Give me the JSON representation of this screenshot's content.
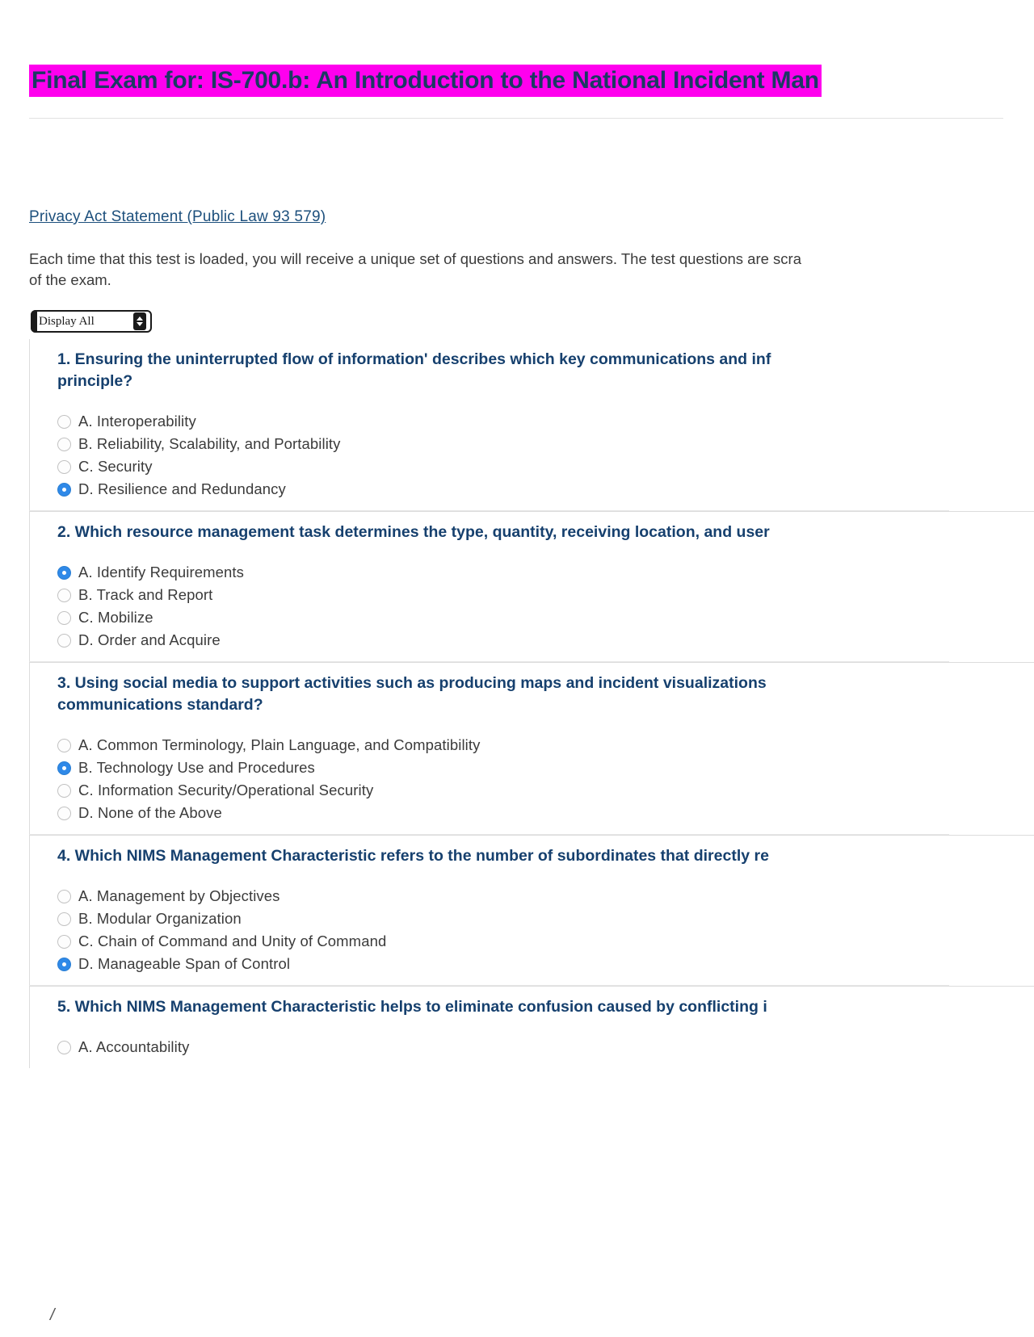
{
  "header": {
    "title": "Final Exam for: IS-700.b: An Introduction to the National Incident Man",
    "highlight_color": "#ff00ee",
    "title_color": "#1b3a63"
  },
  "privacy": {
    "link_text": "Privacy Act Statement (Public Law 93 579)"
  },
  "intro": {
    "paragraph": "Each time that this test is loaded, you will receive a unique set of questions and answers. The test questions are scra\nof the exam."
  },
  "display_select": {
    "selected": "Display All",
    "arrow_up_icon": "triangle-up-icon",
    "arrow_down_icon": "triangle-down-icon"
  },
  "questions": [
    {
      "number": "1.",
      "text": "1. Ensuring the uninterrupted flow of information' describes which key communications and inf\nprinciple?",
      "clip": "clip2",
      "options": [
        {
          "label": "A. Interoperability",
          "selected": false
        },
        {
          "label": "B. Reliability, Scalability, and Portability",
          "selected": false
        },
        {
          "label": "C. Security",
          "selected": false
        },
        {
          "label": "D. Resilience and Redundancy",
          "selected": true
        }
      ]
    },
    {
      "number": "2.",
      "text": "2. Which resource management task determines the type, quantity, receiving location, and user",
      "clip": "clip1",
      "options": [
        {
          "label": "A. Identify Requirements",
          "selected": true
        },
        {
          "label": "B. Track and Report",
          "selected": false
        },
        {
          "label": "C. Mobilize",
          "selected": false
        },
        {
          "label": "D. Order and Acquire",
          "selected": false
        }
      ]
    },
    {
      "number": "3.",
      "text": "3. Using social media to support activities such as producing maps and incident visualizations\ncommunications standard?",
      "clip": "clip2",
      "options": [
        {
          "label": "A. Common Terminology, Plain Language, and Compatibility",
          "selected": false
        },
        {
          "label": "B. Technology Use and Procedures",
          "selected": true
        },
        {
          "label": "C. Information Security/Operational Security",
          "selected": false
        },
        {
          "label": "D. None of the Above",
          "selected": false
        }
      ]
    },
    {
      "number": "4.",
      "text": "4. Which NIMS Management Characteristic refers to the number of subordinates that directly re",
      "clip": "clip1",
      "options": [
        {
          "label": "A. Management by Objectives",
          "selected": false
        },
        {
          "label": "B. Modular Organization",
          "selected": false
        },
        {
          "label": "C. Chain of Command and Unity of Command",
          "selected": false
        },
        {
          "label": "D. Manageable Span of Control",
          "selected": true
        }
      ]
    },
    {
      "number": "5.",
      "text": "5. Which NIMS Management Characteristic helps to eliminate confusion caused by conflicting i",
      "clip": "clip1",
      "options": [
        {
          "label": "A. Accountability",
          "selected": false
        }
      ]
    }
  ],
  "footer": {
    "mark": "/"
  }
}
